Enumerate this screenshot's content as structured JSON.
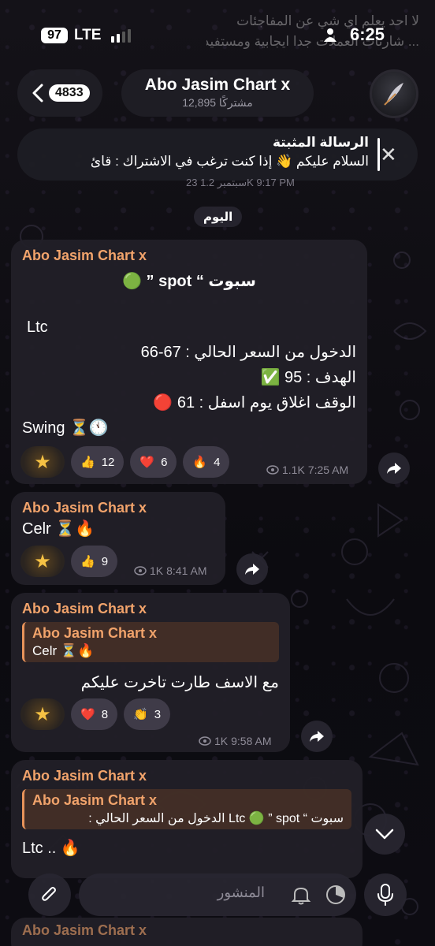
{
  "status_bar": {
    "battery": "97",
    "network": "LTE",
    "time": "6:25"
  },
  "background_peek": {
    "line1": "لا احد يعلم اي شي عن المفاجئات",
    "line2": "... شارتات العملات جدا ايجابية ومستفيدة"
  },
  "header": {
    "back_count": "4833",
    "title": "Abo Jasim Chart x",
    "subtitle": "12,895 مشتركًا"
  },
  "pinned": {
    "title": "الرسالة المثبتة",
    "text": "السلام عليكم 👋 إذا كنت ترغب في الاشتراك : قائ"
  },
  "peek_meta": "23 سبتمبر   1.2K 9:17 PM",
  "date_chip": "اليوم",
  "messages": [
    {
      "sender": "Abo Jasim Chart x",
      "line1": "سبوت “ spot ” 🟢",
      "line2": "Ltc",
      "line3": "الدخول من السعر الحالي :  67-66",
      "line4": "الهدف :  95 ✅",
      "line5": "الوقف اغلاق يوم اسفل :  61 🔴",
      "line6": "Swing ⏳🕚",
      "reactions": [
        {
          "emoji": "👍",
          "count": "12"
        },
        {
          "emoji": "❤️",
          "count": "6"
        },
        {
          "emoji": "🔥",
          "count": "4"
        }
      ],
      "views": "1.1K",
      "time": "7:25 AM"
    },
    {
      "sender": "Abo Jasim Chart x",
      "text": "Celr ⏳🔥",
      "reactions": [
        {
          "emoji": "👍",
          "count": "9"
        }
      ],
      "views": "1K",
      "time": "8:41 AM"
    },
    {
      "sender": "Abo Jasim Chart x",
      "reply_sender": "Abo Jasim Chart x",
      "reply_text": "Celr ⏳🔥",
      "text": "مع الاسف طارت تاخرت عليكم",
      "reactions": [
        {
          "emoji": "❤️",
          "count": "8"
        },
        {
          "emoji": "👏",
          "count": "3"
        }
      ],
      "views": "1K",
      "time": "9:58 AM"
    },
    {
      "sender": "Abo Jasim Chart x",
      "reply_sender": "Abo Jasim Chart x",
      "reply_text": "سبوت “ Ltc 🟢 ” spot الدخول من السعر الحالي :",
      "text": "Ltc .. 🔥"
    }
  ],
  "composer": {
    "placeholder": "المنشور"
  },
  "peek_bottom_sender": "Abo Jasim Chart x",
  "icons": {
    "back": "chevron-left-icon",
    "close": "close-icon",
    "eye": "eye-icon",
    "share": "share-icon",
    "attach": "paperclip-icon",
    "bell": "bell-icon",
    "timer": "timer-icon",
    "mic": "microphone-icon",
    "scroll": "chevron-down-icon"
  },
  "colors": {
    "sender": "#f1a36b",
    "bubble": "#211f28",
    "reply_border": "#e8935a"
  }
}
